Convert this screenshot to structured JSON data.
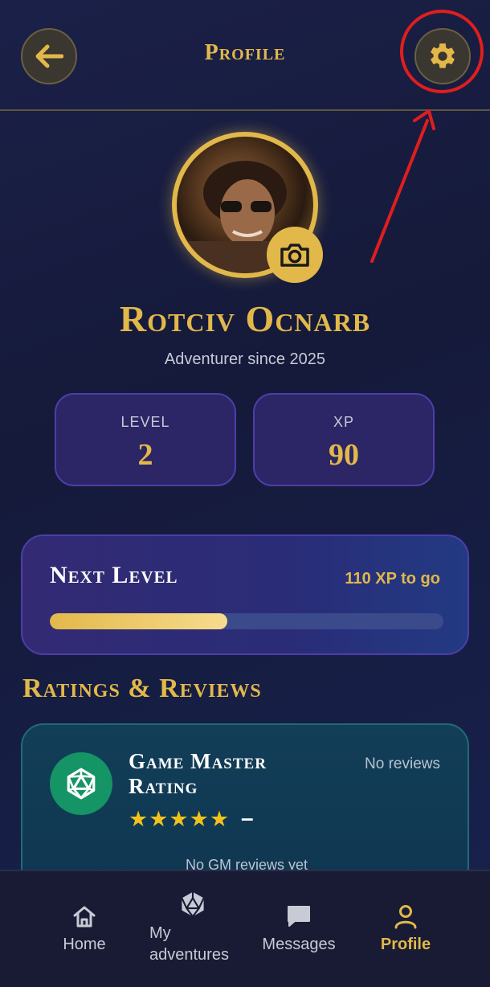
{
  "header": {
    "title": "Profile"
  },
  "profile": {
    "name": "Rotciv Ocnarb",
    "since": "Adventurer since 2025"
  },
  "stats": [
    {
      "label": "LEVEL",
      "value": "2"
    },
    {
      "label": "XP",
      "value": "90"
    }
  ],
  "next_level": {
    "title": "Next Level",
    "to_go": "110 XP to go",
    "progress": 0.45
  },
  "ratings": {
    "section_title": "Ratings & Reviews",
    "gm_title": "Game Master Rating",
    "stars": "★★★★★",
    "score": "–",
    "no_reviews": "No reviews",
    "empty_text": "No GM reviews yet"
  },
  "nav": {
    "home": "Home",
    "adventures_line1": "My",
    "adventures_line2": "adventures",
    "messages": "Messages",
    "profile": "Profile"
  },
  "colors": {
    "accent": "#e2b84a",
    "annotation": "#e01e1e",
    "gm_badge": "#159466"
  },
  "icons": [
    "back-arrow-icon",
    "gear-icon",
    "camera-icon",
    "d20-icon",
    "home-icon",
    "message-icon",
    "person-icon"
  ]
}
